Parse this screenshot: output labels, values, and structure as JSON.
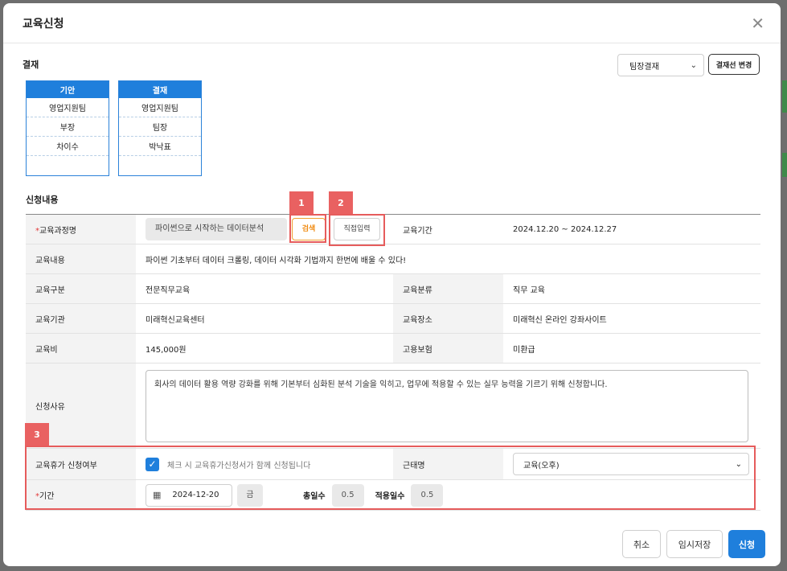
{
  "dialog": {
    "title": "교육신청",
    "close_glyph": "✕"
  },
  "approval": {
    "section_title": "결재",
    "line_select": {
      "value": "팀장결재"
    },
    "change_button": "결재선 변경",
    "drafter": {
      "header": "기안",
      "dept": "영업지원팀",
      "position": "부장",
      "name": "차이수"
    },
    "approver": {
      "header": "결재",
      "dept": "영업지원팀",
      "position": "팀장",
      "name": "박낙표"
    }
  },
  "application": {
    "section_title": "신청내용",
    "course_name": {
      "label": "교육과정명",
      "value": "파이썬으로 시작하는 데이터분석",
      "search_button": "검색",
      "direct_button": "직접입력"
    },
    "period": {
      "label": "교육기간",
      "value": "2024.12.20 ~ 2024.12.27"
    },
    "content": {
      "label": "교육내용",
      "value": "파이썬 기초부터 데이터 크롤링, 데이터 시각화 기법까지 한번에 배울 수 있다!"
    },
    "category": {
      "label": "교육구분",
      "value": "전문직무교육"
    },
    "classification": {
      "label": "교육분류",
      "value": "직무 교육"
    },
    "institution": {
      "label": "교육기관",
      "value": "미래혁신교육센터"
    },
    "location": {
      "label": "교육장소",
      "value": "미래혁신 온라인 강좌사이트"
    },
    "fee": {
      "label": "교육비",
      "value": "145,000원"
    },
    "insurance": {
      "label": "고용보험",
      "value": "미환급"
    },
    "reason": {
      "label": "신청사유",
      "value": "회사의 데이터 활용 역량 강화를 위해 기본부터 심화된 분석 기술을 익히고, 업무에 적용할 수 있는 실무 능력을 기르기 위해 신청합니다."
    },
    "leave": {
      "label": "교육휴가 신청여부",
      "checked": true,
      "check_text": "체크 시 교육휴가신청서가 함께 신청됩니다"
    },
    "attendance": {
      "label": "근태명",
      "value": "교육(오후)"
    },
    "leave_period": {
      "label": "기간",
      "date": "2024-12-20",
      "weekday": "금",
      "total_label": "총일수",
      "total_value": "0.5",
      "applied_label": "적용일수",
      "applied_value": "0.5"
    }
  },
  "annotations": {
    "tag1": "1",
    "tag2": "2",
    "tag3": "3"
  },
  "footer": {
    "cancel": "취소",
    "temp_save": "임시저장",
    "submit": "신청"
  }
}
